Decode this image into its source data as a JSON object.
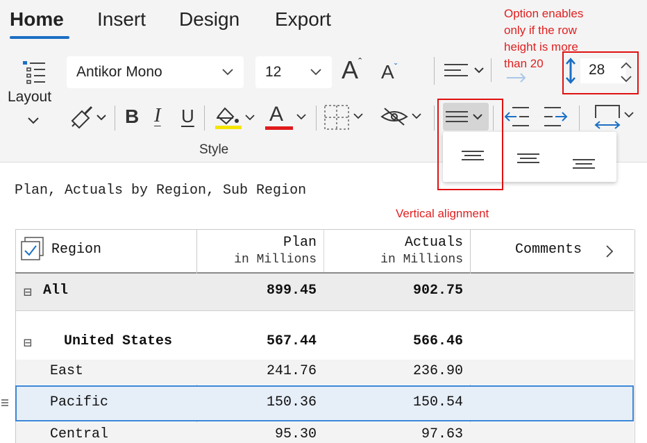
{
  "tabs": [
    {
      "label": "Home",
      "active": true
    },
    {
      "label": "Insert",
      "active": false
    },
    {
      "label": "Design",
      "active": false
    },
    {
      "label": "Export",
      "active": false
    }
  ],
  "ribbon": {
    "layout_label": "Layout",
    "font_name": "Antikor Mono",
    "font_size": "12",
    "row_height": "28",
    "style_group_label": "Style",
    "format_buttons": {
      "bold": "B",
      "italic": "I",
      "underline": "U",
      "font_color": "A"
    },
    "grow_font": "A",
    "shrink_font": "A"
  },
  "annotations": {
    "row_height_note": [
      "Option enables",
      "only if the row",
      "height is more",
      "than 20"
    ],
    "vertical_alignment_note": "Vertical alignment"
  },
  "colors": {
    "accent": "#1a6fc4",
    "annotation_red": "#e02020",
    "highlight_yellow": "#f5e400",
    "font_red": "#e01b1b",
    "selected_row_bg": "#e6eef8",
    "selected_row_border": "#3a86d6"
  },
  "table": {
    "title": "Plan, Actuals by Region, Sub Region",
    "headers": {
      "region": "Region",
      "plan": "Plan",
      "plan_unit": "in Millions",
      "actuals": "Actuals",
      "actuals_unit": "in Millions",
      "comments": "Comments"
    },
    "rows": [
      {
        "label": "All",
        "plan": "899.45",
        "actuals": "902.75",
        "bold": true,
        "collapse": "⊟"
      },
      {
        "label": "United States",
        "plan": "567.44",
        "actuals": "566.46",
        "bold": true,
        "collapse": "⊟"
      },
      {
        "label": "East",
        "plan": "241.76",
        "actuals": "236.90"
      },
      {
        "label": "Pacific",
        "plan": "150.36",
        "actuals": "150.54",
        "selected": true
      },
      {
        "label": "Central",
        "plan": "95.30",
        "actuals": "97.63"
      }
    ]
  }
}
